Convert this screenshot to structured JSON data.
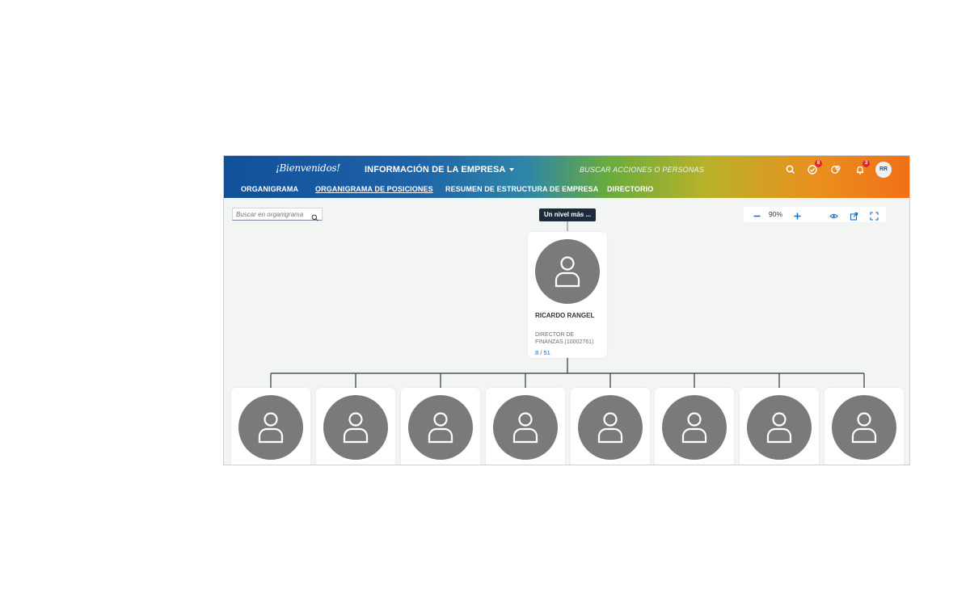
{
  "header": {
    "logo_text": "¡Bienvenidos!",
    "company_label": "INFORMACIÓN DE LA EMPRESA",
    "search_actions": "BUSCAR ACCIONES O PERSONAS",
    "todo_badge": "8",
    "notifications_badge": "3",
    "user_initials": "RR"
  },
  "tabs": [
    {
      "label": "ORGANIGRAMA"
    },
    {
      "label": "ORGANIGRAMA DE POSICIONES"
    },
    {
      "label": "RESUMEN DE ESTRUCTURA DE EMPRESA"
    },
    {
      "label": "DIRECTORIO"
    }
  ],
  "active_tab": "ORGANIGRAMA DE POSICIONES",
  "org_search": {
    "placeholder": "Buscar en organigrama"
  },
  "level_up": {
    "label": "Un nivel más ..."
  },
  "toolbar": {
    "zoom": "90%"
  },
  "manager": {
    "name": "RICARDO RANGEL",
    "title": "DIRECTOR DE FINANZAS (10002761)",
    "count": "8 / 51"
  },
  "colors": {
    "header_start": "#11509b",
    "header_end": "#f26f16",
    "avatar_gray": "#7a7a7a",
    "link_blue": "#0a6ed1",
    "badge_red": "#e2252e"
  }
}
